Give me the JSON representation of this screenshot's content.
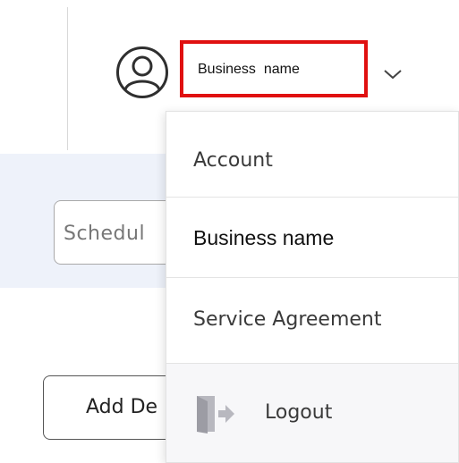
{
  "header": {
    "account_name": "Business  name",
    "user_icon": "user-circle-icon",
    "dropdown_icon": "chevron-down-icon"
  },
  "page": {
    "schedule_input_text": "Schedul",
    "add_button_label": "Add De"
  },
  "menu": {
    "items": [
      {
        "label": "Account"
      },
      {
        "label": "Business name"
      },
      {
        "label": "Service Agreement"
      },
      {
        "label": "Logout",
        "icon": "logout-door-icon"
      }
    ]
  },
  "colors": {
    "highlight_border": "#e01010",
    "band_background": "#eef2fa",
    "logout_icon": "#b8b8bf"
  }
}
